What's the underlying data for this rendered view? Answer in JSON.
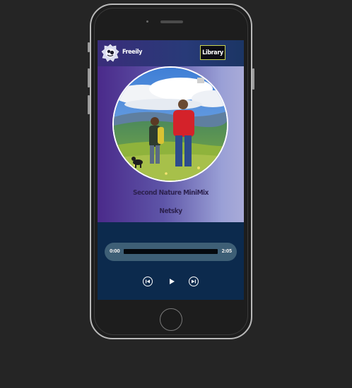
{
  "app": {
    "name": "Freeily"
  },
  "header": {
    "library_label": "Library"
  },
  "now_playing": {
    "title": "Second Nature MiniMix",
    "artist": "Netsky"
  },
  "player": {
    "current_time": "0:00",
    "total_time": "2:05",
    "progress_fraction": 0
  },
  "icons": {
    "logo": "freeily-logo-icon",
    "prev": "skip-previous-icon",
    "play": "play-icon",
    "next": "skip-next-icon"
  },
  "colors": {
    "screen_bg": "#0c2a4d",
    "player_bar": "#3e5f76",
    "library_border": "#c9d250",
    "title_text": "#2d2250"
  }
}
